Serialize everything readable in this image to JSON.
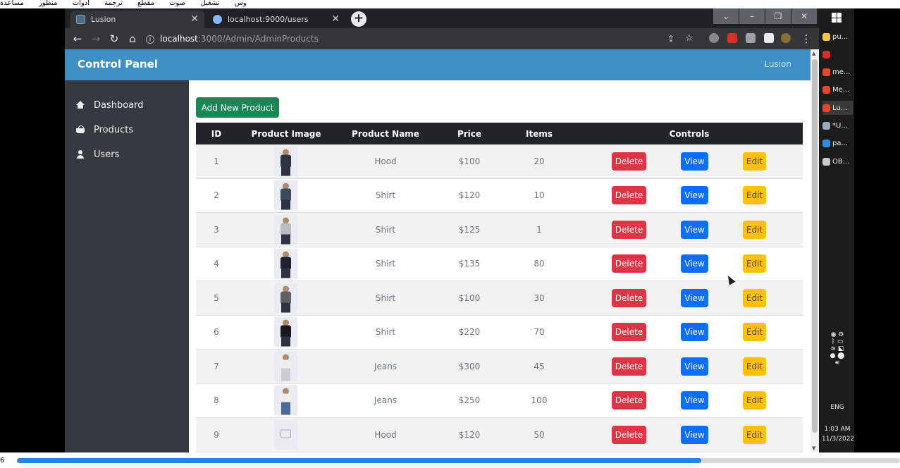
{
  "media_menu": [
    "مساعدة",
    "منظور",
    "أدوات",
    "ترجمة",
    "مقطع",
    "صوت",
    "تشغيل",
    "وس"
  ],
  "browser": {
    "tabs": [
      {
        "label": "Lusion",
        "active": true
      },
      {
        "label": "localhost:9000/users",
        "active": false
      }
    ],
    "address": {
      "host": "localhost",
      "path": ":3000/Admin/AdminProducts"
    }
  },
  "app": {
    "title": "Control Panel",
    "brand": "Lusion",
    "sidebar": [
      {
        "label": "Dashboard",
        "icon": "home-icon"
      },
      {
        "label": "Products",
        "icon": "basket-icon"
      },
      {
        "label": "Users",
        "icon": "user-icon"
      }
    ],
    "add_button": "Add New Product",
    "table": {
      "headers": {
        "id": "ID",
        "image": "Product Image",
        "name": "Product Name",
        "price": "Price",
        "items": "Items",
        "controls": "Controls"
      },
      "rows": [
        {
          "id": "1",
          "name": "Hood",
          "price": "$100",
          "items": "20"
        },
        {
          "id": "2",
          "name": "Shirt",
          "price": "$120",
          "items": "10"
        },
        {
          "id": "3",
          "name": "Shirt",
          "price": "$125",
          "items": "1"
        },
        {
          "id": "4",
          "name": "Shirt",
          "price": "$135",
          "items": "80"
        },
        {
          "id": "5",
          "name": "Shirt",
          "price": "$100",
          "items": "30"
        },
        {
          "id": "6",
          "name": "Shirt",
          "price": "$220",
          "items": "70"
        },
        {
          "id": "7",
          "name": "Jeans",
          "price": "$300",
          "items": "45"
        },
        {
          "id": "8",
          "name": "Jeans",
          "price": "$250",
          "items": "100"
        },
        {
          "id": "9",
          "name": "Hood",
          "price": "$120",
          "items": "50"
        }
      ],
      "buttons": {
        "delete": "Delete",
        "view": "View",
        "edit": "Edit"
      }
    }
  },
  "taskbar": {
    "items": [
      {
        "label": "pu...",
        "color": "#f5c542"
      },
      {
        "label": "",
        "color": "#d92c2c"
      },
      {
        "label": "me...",
        "color": "#e8452c"
      },
      {
        "label": "Me...",
        "color": "#e8452c"
      },
      {
        "label": "Lu...",
        "color": "#e8452c"
      },
      {
        "label": "*U...",
        "color": "#9ab"
      },
      {
        "label": "pa...",
        "color": "#2a8de0"
      },
      {
        "label": "OB...",
        "color": "#ccc"
      }
    ],
    "language": "ENG",
    "time": "1:03 AM",
    "date": "11/3/2022"
  },
  "media": {
    "timecode": "6",
    "progress": 0.775
  }
}
